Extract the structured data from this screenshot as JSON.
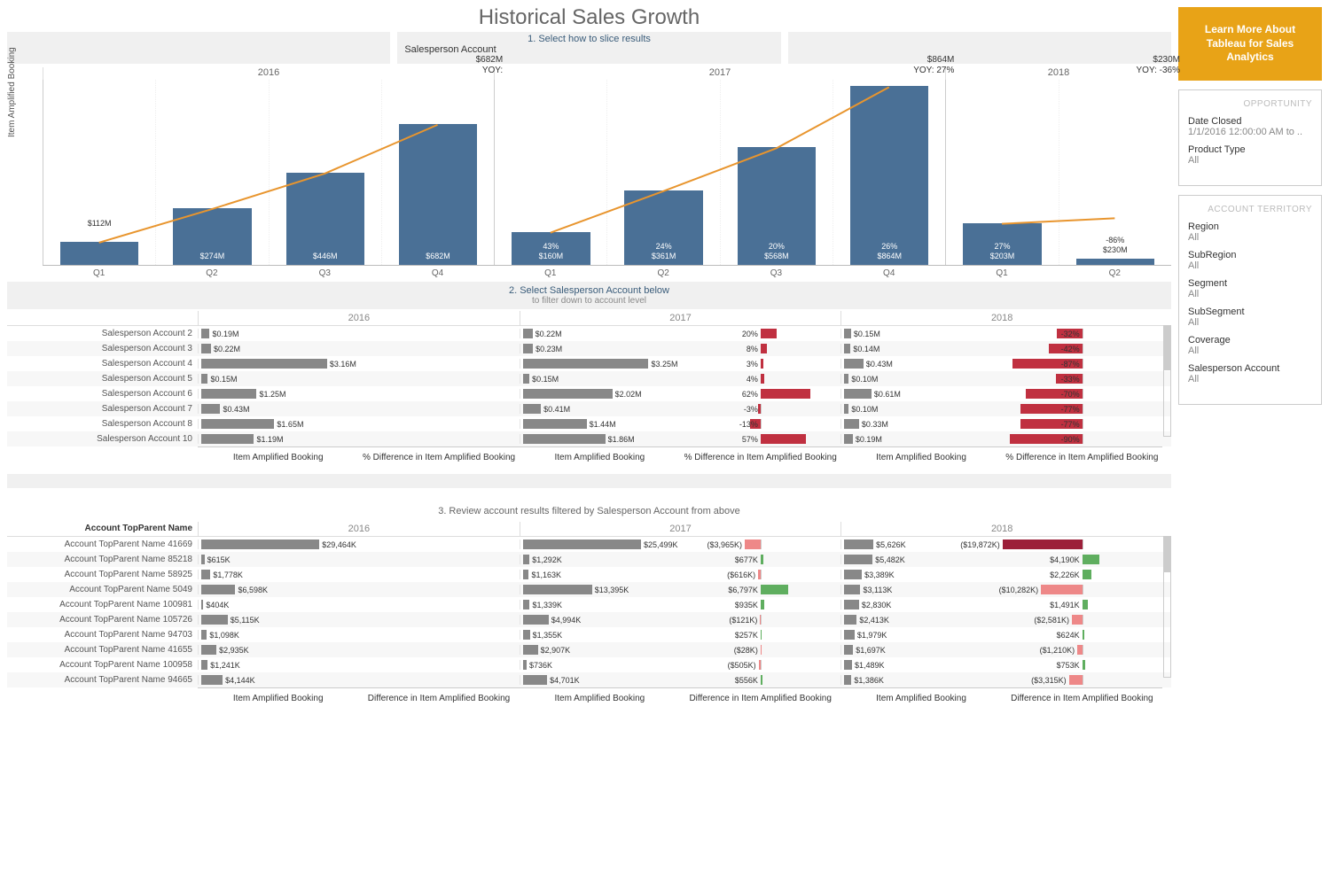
{
  "title": "Historical Sales Growth",
  "cta": "Learn More About Tableau for Sales Analytics",
  "slice": {
    "header": "1. Select how to slice results",
    "value": "Salesperson Account"
  },
  "step2": {
    "line1": "2. Select Salesperson Account below",
    "line2": "to filter down to account level"
  },
  "step3": "3. Review account results filtered by Salesperson Account from above",
  "opportunity_panel": {
    "title": "OPPORTUNITY",
    "fields": [
      {
        "label": "Date Closed",
        "value": "1/1/2016 12:00:00 AM to .."
      },
      {
        "label": "Product Type",
        "value": "All"
      }
    ]
  },
  "territory_panel": {
    "title": "ACCOUNT TERRITORY",
    "fields": [
      {
        "label": "Region",
        "value": "All"
      },
      {
        "label": "SubRegion",
        "value": "All"
      },
      {
        "label": "Segment",
        "value": "All"
      },
      {
        "label": "SubSegment",
        "value": "All"
      },
      {
        "label": "Coverage",
        "value": "All"
      },
      {
        "label": "Salesperson Account",
        "value": "All"
      }
    ]
  },
  "chart_data": {
    "type": "bar",
    "y_axis_label": "Item Amplified Booking",
    "years": [
      "2016",
      "2017",
      "2018"
    ],
    "bars": [
      {
        "year": "2016",
        "q": "Q1",
        "value": 112,
        "label": "$112M",
        "pct": null
      },
      {
        "year": "2016",
        "q": "Q2",
        "value": 274,
        "label": "$274M",
        "pct": null
      },
      {
        "year": "2016",
        "q": "Q3",
        "value": 446,
        "label": "$446M",
        "pct": null
      },
      {
        "year": "2016",
        "q": "Q4",
        "value": 682,
        "label": "$682M",
        "pct": null,
        "callout": "$682M\nYOY:"
      },
      {
        "year": "2017",
        "q": "Q1",
        "value": 160,
        "label": "$160M",
        "pct": "43%"
      },
      {
        "year": "2017",
        "q": "Q2",
        "value": 361,
        "label": "$361M",
        "pct": "24%"
      },
      {
        "year": "2017",
        "q": "Q3",
        "value": 568,
        "label": "$568M",
        "pct": "20%"
      },
      {
        "year": "2017",
        "q": "Q4",
        "value": 864,
        "label": "$864M",
        "pct": "26%",
        "callout": "$864M\nYOY: 27%"
      },
      {
        "year": "2018",
        "q": "Q1",
        "value": 203,
        "label": "$203M",
        "pct": "27%"
      },
      {
        "year": "2018",
        "q": "Q2",
        "value": 230,
        "label": "$230M",
        "pct": "-86%",
        "bar_value": 28,
        "callout": "$230M\nYOY: -36%"
      }
    ],
    "line_series": [
      [
        112,
        274,
        446,
        682
      ],
      [
        160,
        361,
        568,
        864
      ],
      [
        203,
        230
      ]
    ],
    "ymax": 900
  },
  "salesperson_table": {
    "years": [
      "2016",
      "2017",
      "2018"
    ],
    "col_labels": {
      "booking": "Item Amplified Booking",
      "pct": "% Difference in Item Amplified Booking"
    },
    "max_booking": 3.5,
    "rows": [
      {
        "name": "Salesperson Account 2",
        "b16": 0.19,
        "l16": "$0.19M",
        "b17": 0.22,
        "l17": "$0.22M",
        "p17": 20,
        "b18": 0.15,
        "l18": "$0.15M",
        "p18": -32
      },
      {
        "name": "Salesperson Account 3",
        "b16": 0.22,
        "l16": "$0.22M",
        "b17": 0.23,
        "l17": "$0.23M",
        "p17": 8,
        "b18": 0.14,
        "l18": "$0.14M",
        "p18": -42
      },
      {
        "name": "Salesperson Account 4",
        "b16": 3.16,
        "l16": "$3.16M",
        "b17": 3.25,
        "l17": "$3.25M",
        "p17": 3,
        "b18": 0.43,
        "l18": "$0.43M",
        "p18": -87
      },
      {
        "name": "Salesperson Account 5",
        "b16": 0.15,
        "l16": "$0.15M",
        "b17": 0.15,
        "l17": "$0.15M",
        "p17": 4,
        "b18": 0.1,
        "l18": "$0.10M",
        "p18": -33
      },
      {
        "name": "Salesperson Account 6",
        "b16": 1.25,
        "l16": "$1.25M",
        "b17": 2.02,
        "l17": "$2.02M",
        "p17": 62,
        "b18": 0.61,
        "l18": "$0.61M",
        "p18": -70
      },
      {
        "name": "Salesperson Account 7",
        "b16": 0.43,
        "l16": "$0.43M",
        "b17": 0.41,
        "l17": "$0.41M",
        "p17": -3,
        "b18": 0.1,
        "l18": "$0.10M",
        "p18": -77
      },
      {
        "name": "Salesperson Account 8",
        "b16": 1.65,
        "l16": "$1.65M",
        "b17": 1.44,
        "l17": "$1.44M",
        "p17": -13,
        "b18": 0.33,
        "l18": "$0.33M",
        "p18": -77
      },
      {
        "name": "Salesperson Account 10",
        "b16": 1.19,
        "l16": "$1.19M",
        "b17": 1.86,
        "l17": "$1.86M",
        "p17": 57,
        "b18": 0.19,
        "l18": "$0.19M",
        "p18": -90
      }
    ]
  },
  "account_table": {
    "header": "Account TopParent Name",
    "years": [
      "2016",
      "2017",
      "2018"
    ],
    "col_labels": {
      "booking": "Item Amplified Booking",
      "diff": "Difference in Item Amplified Booking"
    },
    "max_booking": 30000,
    "max_diff": 20000,
    "rows": [
      {
        "name": "Account TopParent Name 41669",
        "b16": 29464,
        "l16": "$29,464K",
        "b17": 25499,
        "l17": "$25,499K",
        "d17": -3965,
        "ld17": "($3,965K)",
        "b18": 5626,
        "l18": "$5,626K",
        "d18": -19872,
        "ld18": "($19,872K)",
        "c18": "crimson"
      },
      {
        "name": "Account TopParent Name 85218",
        "b16": 615,
        "l16": "$615K",
        "b17": 1292,
        "l17": "$1,292K",
        "d17": 677,
        "ld17": "$677K",
        "b18": 5482,
        "l18": "$5,482K",
        "d18": 4190,
        "ld18": "$4,190K",
        "c18": "green"
      },
      {
        "name": "Account TopParent Name 58925",
        "b16": 1778,
        "l16": "$1,778K",
        "b17": 1163,
        "l17": "$1,163K",
        "d17": -616,
        "ld17": "($616K)",
        "b18": 3389,
        "l18": "$3,389K",
        "d18": 2226,
        "ld18": "$2,226K",
        "c18": "green"
      },
      {
        "name": "Account TopParent Name 5049",
        "b16": 6598,
        "l16": "$6,598K",
        "b17": 13395,
        "l17": "$13,395K",
        "d17": 6797,
        "ld17": "$6,797K",
        "c17": "green",
        "b18": 3113,
        "l18": "$3,113K",
        "d18": -10282,
        "ld18": "($10,282K)",
        "c18": "salmon"
      },
      {
        "name": "Account TopParent Name 100981",
        "b16": 404,
        "l16": "$404K",
        "b17": 1339,
        "l17": "$1,339K",
        "d17": 935,
        "ld17": "$935K",
        "b18": 2830,
        "l18": "$2,830K",
        "d18": 1491,
        "ld18": "$1,491K",
        "c18": "green"
      },
      {
        "name": "Account TopParent Name 105726",
        "b16": 5115,
        "l16": "$5,115K",
        "b17": 4994,
        "l17": "$4,994K",
        "d17": -121,
        "ld17": "($121K)",
        "b18": 2413,
        "l18": "$2,413K",
        "d18": -2581,
        "ld18": "($2,581K)",
        "c18": "salmon"
      },
      {
        "name": "Account TopParent Name 94703",
        "b16": 1098,
        "l16": "$1,098K",
        "b17": 1355,
        "l17": "$1,355K",
        "d17": 257,
        "ld17": "$257K",
        "b18": 1979,
        "l18": "$1,979K",
        "d18": 624,
        "ld18": "$624K",
        "c18": "green"
      },
      {
        "name": "Account TopParent Name 41655",
        "b16": 2935,
        "l16": "$2,935K",
        "b17": 2907,
        "l17": "$2,907K",
        "d17": -28,
        "ld17": "($28K)",
        "b18": 1697,
        "l18": "$1,697K",
        "d18": -1210,
        "ld18": "($1,210K)",
        "c18": "salmon"
      },
      {
        "name": "Account TopParent Name 100958",
        "b16": 1241,
        "l16": "$1,241K",
        "b17": 736,
        "l17": "$736K",
        "d17": -505,
        "ld17": "($505K)",
        "b18": 1489,
        "l18": "$1,489K",
        "d18": 753,
        "ld18": "$753K",
        "c18": "green"
      },
      {
        "name": "Account TopParent Name 94665",
        "b16": 4144,
        "l16": "$4,144K",
        "b17": 4701,
        "l17": "$4,701K",
        "d17": 556,
        "ld17": "$556K",
        "b18": 1386,
        "l18": "$1,386K",
        "d18": -3315,
        "ld18": "($3,315K)",
        "c18": "salmon"
      }
    ]
  }
}
